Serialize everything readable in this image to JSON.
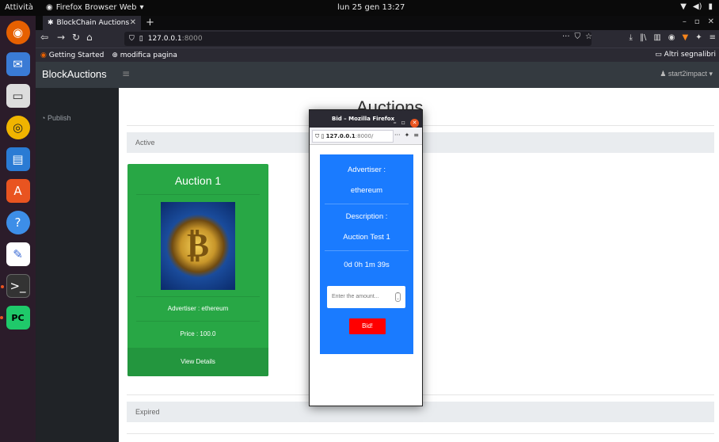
{
  "topbar": {
    "activities": "Attività",
    "app_name": "Firefox Browser Web",
    "clock": "lun 25 gen 13:27"
  },
  "browser": {
    "tab_title": "BlockChain Auctions",
    "url_host": "127.0.0.1",
    "url_port": ":8000",
    "bookmarks": [
      "Getting Started",
      "modifica pagina"
    ],
    "other_bookmarks": "Altri segnalibri"
  },
  "site": {
    "brand": "BlockAuctions",
    "user": "start2impact",
    "sidebar_link": "Publish",
    "heading": "Auctions",
    "active_label": "Active",
    "expired_label": "Expired"
  },
  "card": {
    "title": "Auction 1",
    "advertiser": "Advertiser : ethereum",
    "price": "Price : 100.0",
    "button": "View Details",
    "color": "#28a745"
  },
  "popup": {
    "title": "Bid – Mozilla Firefox",
    "url_host": "127.0.0.1",
    "url_port": ":8000/",
    "advertiser_label": "Advertiser :",
    "advertiser_value": "ethereum",
    "description_label": "Description :",
    "description_value": "Auction Test 1",
    "countdown": "0d 0h 1m 39s",
    "amount_placeholder": "Enter the amount...",
    "bid_button": "Bid!",
    "panel_color": "#1a7bff",
    "button_color": "#ff0000"
  }
}
